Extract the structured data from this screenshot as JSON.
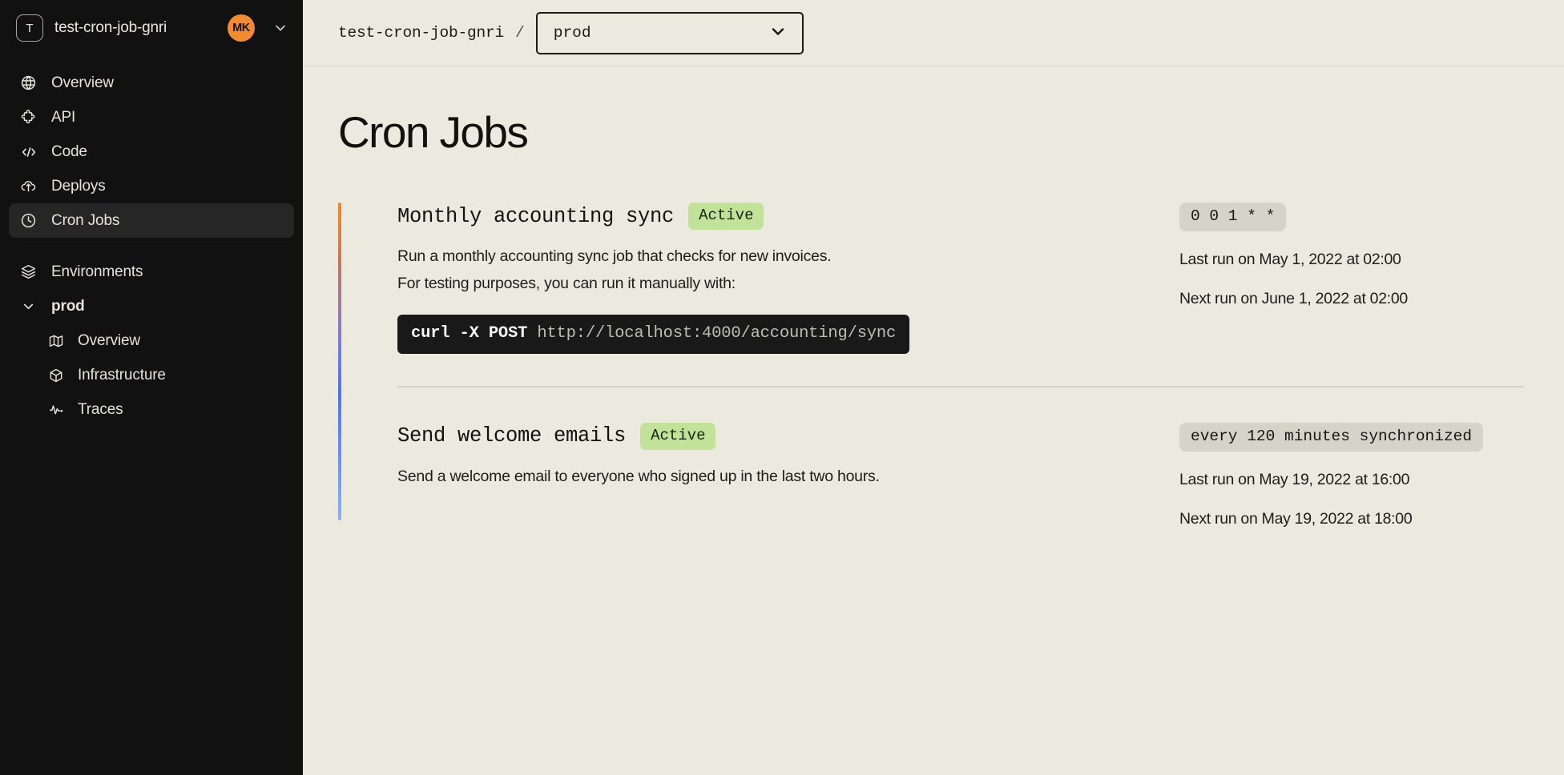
{
  "sidebar": {
    "project_initial": "T",
    "project_name": "test-cron-job-gnri",
    "avatar_initials": "MK",
    "nav": [
      {
        "label": "Overview",
        "icon": "globe-icon",
        "active": false
      },
      {
        "label": "API",
        "icon": "puzzle-icon",
        "active": false
      },
      {
        "label": "Code",
        "icon": "code-brackets-icon",
        "active": false
      },
      {
        "label": "Deploys",
        "icon": "cloud-upload-icon",
        "active": false
      },
      {
        "label": "Cron Jobs",
        "icon": "clock-icon",
        "active": true
      }
    ],
    "environments_label": "Environments",
    "environment_name": "prod",
    "env_children": [
      {
        "label": "Overview",
        "icon": "map-icon"
      },
      {
        "label": "Infrastructure",
        "icon": "cube-icon"
      },
      {
        "label": "Traces",
        "icon": "activity-icon"
      }
    ]
  },
  "topbar": {
    "breadcrumb_project": "test-cron-job-gnri",
    "breadcrumb_separator": "/",
    "env_selected": "prod"
  },
  "page": {
    "title": "Cron Jobs"
  },
  "jobs": [
    {
      "title": "Monthly accounting sync",
      "status": "Active",
      "description_line1": "Run a monthly accounting sync job that checks for new invoices.",
      "description_line2": "For testing purposes, you can run it manually with:",
      "code_command": "curl -X POST ",
      "code_url": "http://localhost:4000/accounting/sync",
      "schedule": "0 0 1 * *",
      "last_run": "Last run on May 1, 2022 at 02:00",
      "next_run": "Next run on June 1, 2022 at 02:00"
    },
    {
      "title": "Send welcome emails",
      "status": "Active",
      "description_line1": "Send a welcome email to everyone who signed up in the last two hours.",
      "schedule": "every 120 minutes synchronized",
      "last_run": "Last run on May 19, 2022 at 16:00",
      "next_run": "Next run on May 19, 2022 at 18:00"
    }
  ],
  "colors": {
    "sidebar_bg": "#111111",
    "sidebar_active": "#262626",
    "page_bg": "#ece9de",
    "accent_orange": "#f0892e",
    "accent_blue": "#4f6ef5",
    "badge_green": "#c2e29a",
    "pill_gray": "#d6d4c8",
    "code_bg": "#19191a"
  }
}
